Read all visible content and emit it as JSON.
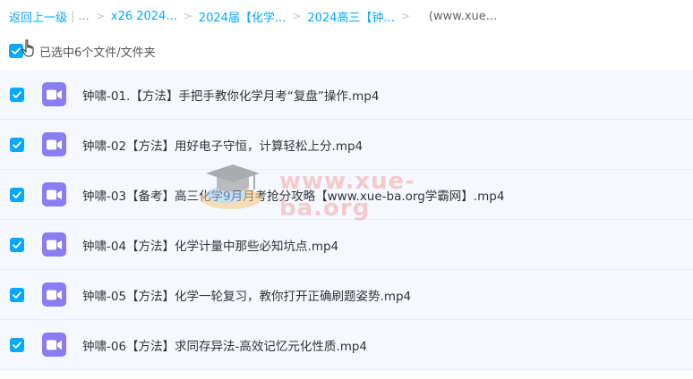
{
  "breadcrumb": {
    "back_label": "返回上一级",
    "ellipsis": "...",
    "items": [
      "x26 2024...",
      "2024届【化学...",
      "2024高三【钟..."
    ],
    "current": "(www.xue..."
  },
  "selection": {
    "label": "已选中6个文件/文件夹",
    "checked": true
  },
  "files": [
    {
      "name": "钟啸-01.【方法】手把手教你化学月考“复盘”操作.mp4",
      "checked": true,
      "icon": "video-icon"
    },
    {
      "name": "钟啸-02【方法】用好电子守恒，计算轻松上分.mp4",
      "checked": true,
      "icon": "video-icon"
    },
    {
      "name": "钟啸-03【备考】高三化学9月月考抢分攻略【www.xue-ba.org学霸网】.mp4",
      "checked": true,
      "icon": "video-icon"
    },
    {
      "name": "钟啸-04【方法】化学计量中那些必知坑点.mp4",
      "checked": true,
      "icon": "video-icon"
    },
    {
      "name": "钟啸-05【方法】化学一轮复习，教你打开正确刷题姿势.mp4",
      "checked": true,
      "icon": "video-icon"
    },
    {
      "name": "钟啸-06【方法】求同存异法-高效记忆元化性质.mp4",
      "checked": true,
      "icon": "video-icon"
    }
  ],
  "watermark": {
    "text": "www.xue-ba.org"
  },
  "colors": {
    "accent": "#06a7ff",
    "row_bg": "#f5f9ff",
    "video_icon": "#8a7cf1"
  }
}
